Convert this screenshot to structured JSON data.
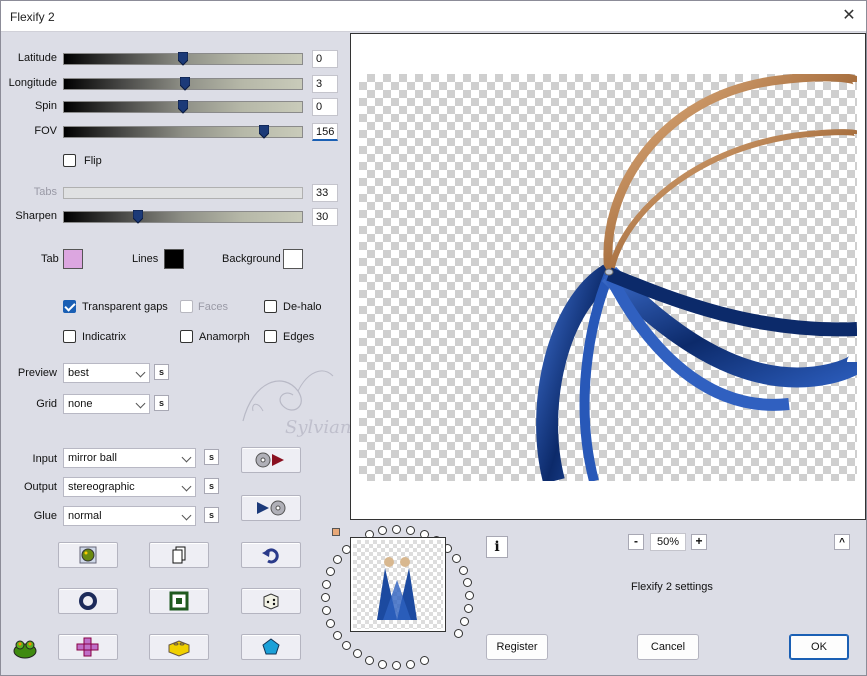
{
  "window": {
    "title": "Flexify 2",
    "close_glyph": "✕"
  },
  "sliders": [
    {
      "key": "latitude",
      "label": "Latitude",
      "value": "0",
      "level": 0.5,
      "enabled": true
    },
    {
      "key": "longitude",
      "label": "Longitude",
      "value": "3",
      "level": 0.51,
      "enabled": true
    },
    {
      "key": "spin",
      "label": "Spin",
      "value": "0",
      "level": 0.5,
      "enabled": true
    },
    {
      "key": "fov",
      "label": "FOV",
      "value": "156",
      "level": 0.84,
      "enabled": true
    },
    {
      "key": "tabs",
      "label": "Tabs",
      "value": "33",
      "enabled": false
    },
    {
      "key": "sharpen",
      "label": "Sharpen",
      "value": "30",
      "level": 0.31,
      "enabled": true
    }
  ],
  "flip": {
    "label": "Flip",
    "checked": false
  },
  "colors": {
    "tab": {
      "label": "Tab",
      "value": "#dca6e0"
    },
    "lines": {
      "label": "Lines",
      "value": "#000000"
    },
    "background": {
      "label": "Background",
      "value": "#ffffff"
    }
  },
  "options": {
    "transparent_gaps": {
      "label": "Transparent gaps",
      "checked": true
    },
    "faces": {
      "label": "Faces",
      "checked": false,
      "enabled": false
    },
    "de_halo": {
      "label": "De-halo",
      "checked": false
    },
    "indicatrix": {
      "label": "Indicatrix",
      "checked": false
    },
    "anamorph": {
      "label": "Anamorph",
      "checked": false
    },
    "edges": {
      "label": "Edges",
      "checked": false
    }
  },
  "preview": {
    "label": "Preview",
    "value": "best"
  },
  "grid": {
    "label": "Grid",
    "value": "none"
  },
  "input": {
    "label": "Input",
    "value": "mirror ball"
  },
  "output": {
    "label": "Output",
    "value": "stereographic"
  },
  "glue": {
    "label": "Glue",
    "value": "normal"
  },
  "s_button": "s",
  "zoom": {
    "value": "50%",
    "minus": "-",
    "plus": "+"
  },
  "settings_caption": "Flexify 2 settings",
  "buttons": {
    "register": "Register",
    "cancel": "Cancel",
    "ok": "OK"
  },
  "info_glyph": "i",
  "collapse_glyph": "^",
  "watermark": "Sylviane"
}
